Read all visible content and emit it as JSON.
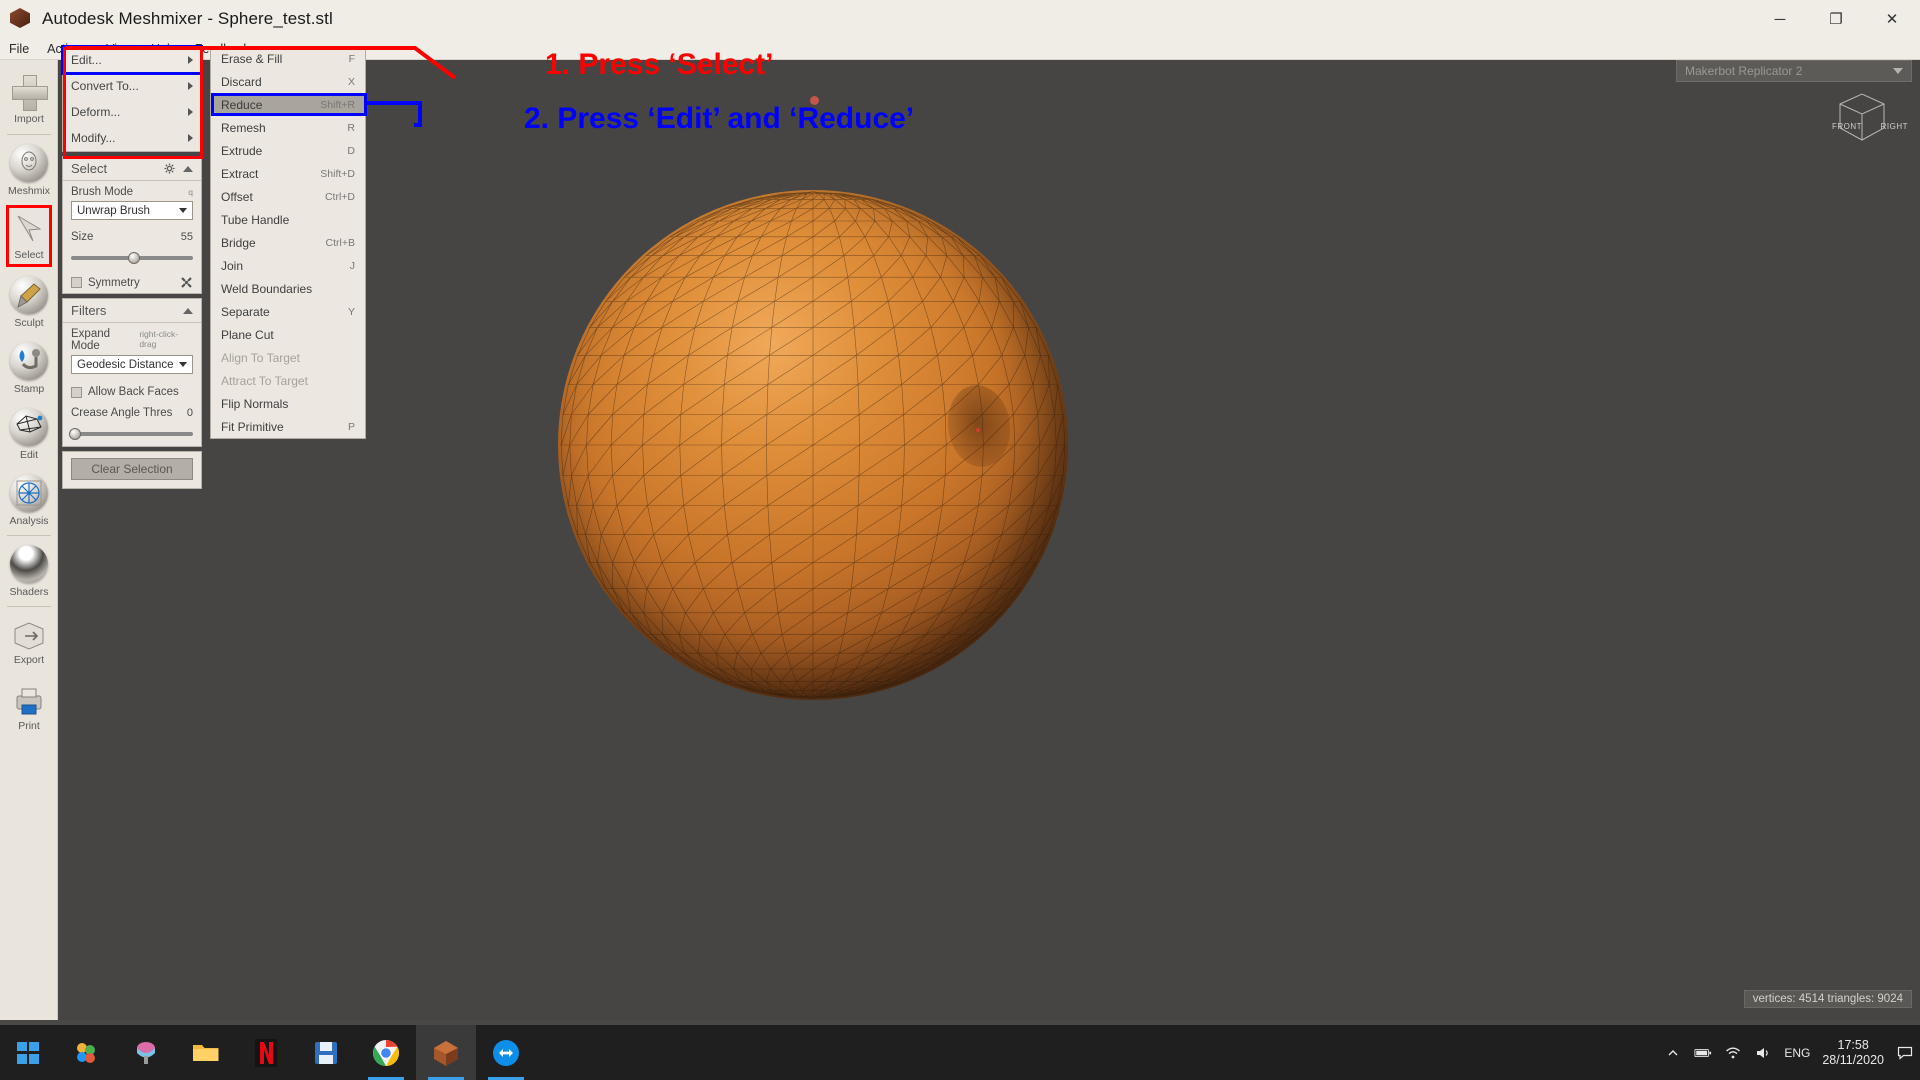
{
  "window": {
    "title": "Autodesk Meshmixer - Sphere_test.stl",
    "app_icon": "meshmixer-cube-icon",
    "minimize": "─",
    "maximize": "❐",
    "close": "✕"
  },
  "menubar": {
    "items": [
      {
        "label": "File"
      },
      {
        "label": "Actions"
      },
      {
        "label": "View"
      },
      {
        "label": "Help"
      },
      {
        "label": "Feedback"
      }
    ]
  },
  "rail": {
    "items": [
      {
        "label": "Import",
        "icon": "plus-icon",
        "active": false
      },
      {
        "label": "Meshmix",
        "icon": "face-sphere-icon",
        "active": false
      },
      {
        "label": "Select",
        "icon": "cursor-arrow-icon",
        "active": true
      },
      {
        "label": "Sculpt",
        "icon": "brush-icon",
        "active": false
      },
      {
        "label": "Stamp",
        "icon": "stamp-icon",
        "active": false
      },
      {
        "label": "Edit",
        "icon": "mesh-edit-icon",
        "active": false
      },
      {
        "label": "Analysis",
        "icon": "wireframe-analysis-icon",
        "active": false
      },
      {
        "label": "Shaders",
        "icon": "shader-ball-icon",
        "active": false
      },
      {
        "label": "Export",
        "icon": "export-icon",
        "active": false
      },
      {
        "label": "Print",
        "icon": "printer-icon",
        "active": false
      }
    ]
  },
  "panel": {
    "actions": [
      {
        "label": "Edit...",
        "highlighted": true
      },
      {
        "label": "Convert To...",
        "highlighted": false
      },
      {
        "label": "Deform...",
        "highlighted": false
      },
      {
        "label": "Modify...",
        "highlighted": false
      }
    ],
    "select_section": {
      "title": "Select",
      "gear_icon": "gear-icon",
      "collapse_icon": "caret-up-icon",
      "brush_mode_label": "Brush Mode",
      "brush_mode_value": "Unwrap Brush",
      "size_label": "Size",
      "size_value": "55",
      "size_percent": 52,
      "symmetry_label": "Symmetry",
      "symmetry_checked": false,
      "wrench_icon": "wrench-icon"
    },
    "filters_section": {
      "title": "Filters",
      "collapse_icon": "caret-up-icon",
      "expand_mode_label": "Expand Mode",
      "expand_mode_hint": "right-click-drag",
      "expand_mode_value": "Geodesic Distance",
      "allow_back_faces_label": "Allow Back Faces",
      "allow_back_faces_checked": false,
      "crease_angle_label": "Crease Angle Thres",
      "crease_angle_value": "0",
      "crease_percent": 3
    },
    "clear_button": "Clear Selection"
  },
  "flyout": {
    "items": [
      {
        "label": "Erase & Fill",
        "key": "F",
        "state": "normal"
      },
      {
        "label": "Discard",
        "key": "X",
        "state": "normal"
      },
      {
        "label": "Reduce",
        "key": "Shift+R",
        "state": "selected"
      },
      {
        "label": "Remesh",
        "key": "R",
        "state": "normal"
      },
      {
        "label": "Extrude",
        "key": "D",
        "state": "normal"
      },
      {
        "label": "Extract",
        "key": "Shift+D",
        "state": "normal"
      },
      {
        "label": "Offset",
        "key": "Ctrl+D",
        "state": "normal"
      },
      {
        "label": "Tube Handle",
        "key": "",
        "state": "normal"
      },
      {
        "label": "Bridge",
        "key": "Ctrl+B",
        "state": "normal"
      },
      {
        "label": "Join",
        "key": "J",
        "state": "normal"
      },
      {
        "label": "Weld Boundaries",
        "key": "",
        "state": "normal"
      },
      {
        "label": "Separate",
        "key": "Y",
        "state": "normal"
      },
      {
        "label": "Plane Cut",
        "key": "",
        "state": "normal"
      },
      {
        "label": "Align To Target",
        "key": "",
        "state": "disabled"
      },
      {
        "label": "Attract To Target",
        "key": "",
        "state": "disabled"
      },
      {
        "label": "Flip Normals",
        "key": "",
        "state": "normal"
      },
      {
        "label": "Fit Primitive",
        "key": "P",
        "state": "normal"
      }
    ]
  },
  "viewport": {
    "printer_name": "Makerbot Replicator 2",
    "printer_dropdown_icon": "chevron-down-icon",
    "viewcube": {
      "front_label": "FRONT",
      "right_label": "RIGHT"
    },
    "status": "vertices: 4514 triangles: 9024",
    "model_color": "#d98a36"
  },
  "annotations": [
    {
      "text": "1. Press ‘Select’",
      "color": "#ff0000"
    },
    {
      "text": "2. Press ‘Edit’ and ‘Reduce’",
      "color": "#0000ff"
    }
  ],
  "taskbar": {
    "start_icon": "windows-start-icon",
    "apps": [
      {
        "name": "photos-icon",
        "running": false
      },
      {
        "name": "paint3d-icon",
        "running": false
      },
      {
        "name": "file-explorer-icon",
        "running": false
      },
      {
        "name": "netflix-icon",
        "running": false
      },
      {
        "name": "save-blue-icon",
        "running": false
      },
      {
        "name": "chrome-icon",
        "running": true
      },
      {
        "name": "meshmixer-icon",
        "running": true,
        "active": true
      },
      {
        "name": "teamviewer-icon",
        "running": true
      }
    ],
    "tray": {
      "chevron_up_icon": "chevron-up-icon",
      "battery_icon": "battery-icon",
      "wifi_icon": "wifi-icon",
      "volume_icon": "volume-icon",
      "language": "ENG",
      "time": "17:58",
      "date": "28/11/2020",
      "action_center_icon": "action-center-icon"
    }
  }
}
